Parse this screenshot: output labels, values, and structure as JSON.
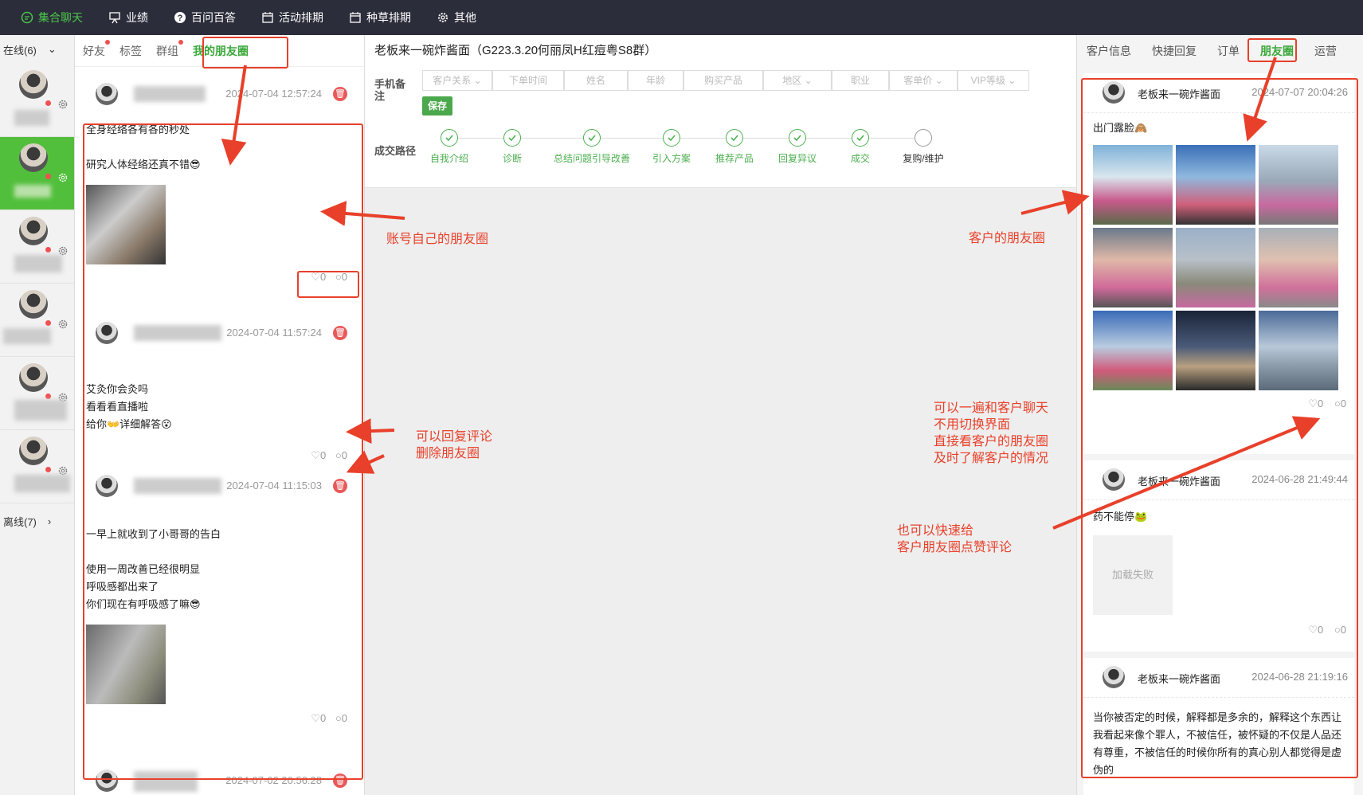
{
  "topbar": {
    "items": [
      "集合聊天",
      "业绩",
      "百问百答",
      "活动排期",
      "种草排期",
      "其他"
    ]
  },
  "contacts": {
    "online_label": "在线(6)",
    "offline_label": "离线(7)"
  },
  "feed": {
    "tabs": [
      "好友",
      "标签",
      "群组",
      "我的朋友圈"
    ],
    "posts": [
      {
        "time": "2024-07-04 12:57:24",
        "text": [
          "全身经络各有各的秒处",
          "",
          "研究人体经络还真不错😎"
        ],
        "likes": "0",
        "comments": "0"
      },
      {
        "time": "2024-07-04 11:57:24",
        "text": [
          "艾灸你会灸吗",
          "看看看直播啦",
          "给你👐详细解答😮"
        ],
        "likes": "0",
        "comments": "0"
      },
      {
        "time": "2024-07-04 11:15:03",
        "text": [
          "一早上就收到了小哥哥的告白",
          "",
          "使用一周改善已经很明显",
          "呼吸感都出来了",
          "你们现在有呼吸感了嘛😎"
        ],
        "likes": "0",
        "comments": "0"
      },
      {
        "time": "2024-07-02 20:56:28"
      }
    ]
  },
  "customer": {
    "title": "老板来一碗炸酱面（G223.3.20何丽凤H红痘粤S8群）",
    "phone_label": "手机备注",
    "fields": [
      "客户关系",
      "下单时间",
      "姓名",
      "年龄",
      "购买产品",
      "地区",
      "职业",
      "客单价",
      "VIP等级"
    ],
    "save_label": "保存",
    "path_label": "成交路径",
    "steps": [
      "自我介绍",
      "诊断",
      "总结问题引导改善",
      "引入方案",
      "推荐产品",
      "回复异议",
      "成交",
      "复购/维护"
    ]
  },
  "right": {
    "tabs": [
      "客户信息",
      "快捷回复",
      "订单",
      "朋友圈",
      "运营"
    ],
    "posts": [
      {
        "name": "老板来一碗炸酱面",
        "time": "2024-07-07 20:04:26",
        "text": "出门露脸🙈",
        "likes": "0",
        "comments": "0"
      },
      {
        "name": "老板来一碗炸酱面",
        "time": "2024-06-28 21:49:44",
        "text": "药不能停🐸",
        "fail": "加载失败",
        "likes": "0",
        "comments": "0"
      },
      {
        "name": "老板来一碗炸酱面",
        "time": "2024-06-28 21:19:16",
        "text": "当你被否定的时候，解释都是多余的，解释这个东西让我看起来像个罪人，不被信任，被怀疑的不仅是人品还有尊重，不被信任的时候你所有的真心别人都觉得是虚伪的"
      }
    ]
  },
  "annotations": {
    "own_moments": "账号自己的朋友圈",
    "reply_delete": [
      "可以回复评论",
      "删除朋友圈"
    ],
    "customer_moments": "客户的朋友圈",
    "chat_while": [
      "可以一遍和客户聊天",
      "不用切换界面",
      "直接看客户的朋友圈",
      "及时了解客户的情况"
    ],
    "like_comment": [
      "也可以快速给",
      "客户朋友圈点赞评论"
    ]
  },
  "colors": {
    "accent": "#3aa83a",
    "annotation": "#e8402a",
    "topbar": "#2b2d3a"
  }
}
